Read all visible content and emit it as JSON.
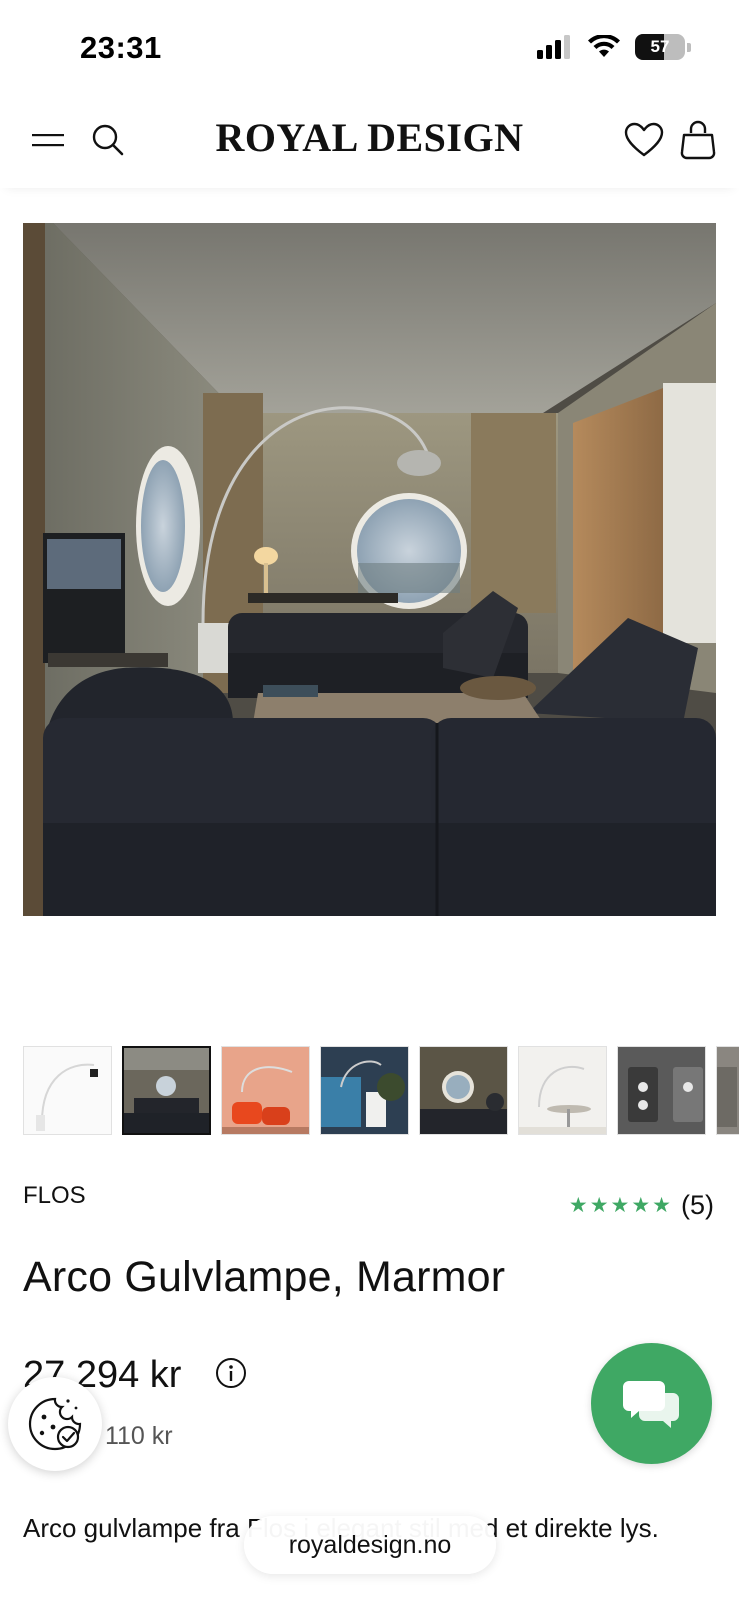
{
  "status_bar": {
    "time": "23:31",
    "battery_level": "57",
    "icons": [
      "cellular-signal-icon",
      "wifi-icon",
      "battery-icon"
    ]
  },
  "header": {
    "brand": "ROYAL DESIGN",
    "icons": [
      "menu-icon",
      "search-icon",
      "heart-icon",
      "bag-icon"
    ]
  },
  "product": {
    "brand": "FLOS",
    "rating_stars": 5,
    "rating_count": "(5)",
    "title": "Arco Gulvlampe, Marmor",
    "price": "27 294 kr",
    "original_price": "pris 32 110 kr",
    "description": "Arco gulvlampe fra Flos i elegant stil med et direkte lys.",
    "thumbnail_count": 8,
    "active_thumbnail": 2
  },
  "browser": {
    "url": "royaldesign.no"
  },
  "colors": {
    "accent_green": "#3fa864",
    "text": "#111111"
  }
}
